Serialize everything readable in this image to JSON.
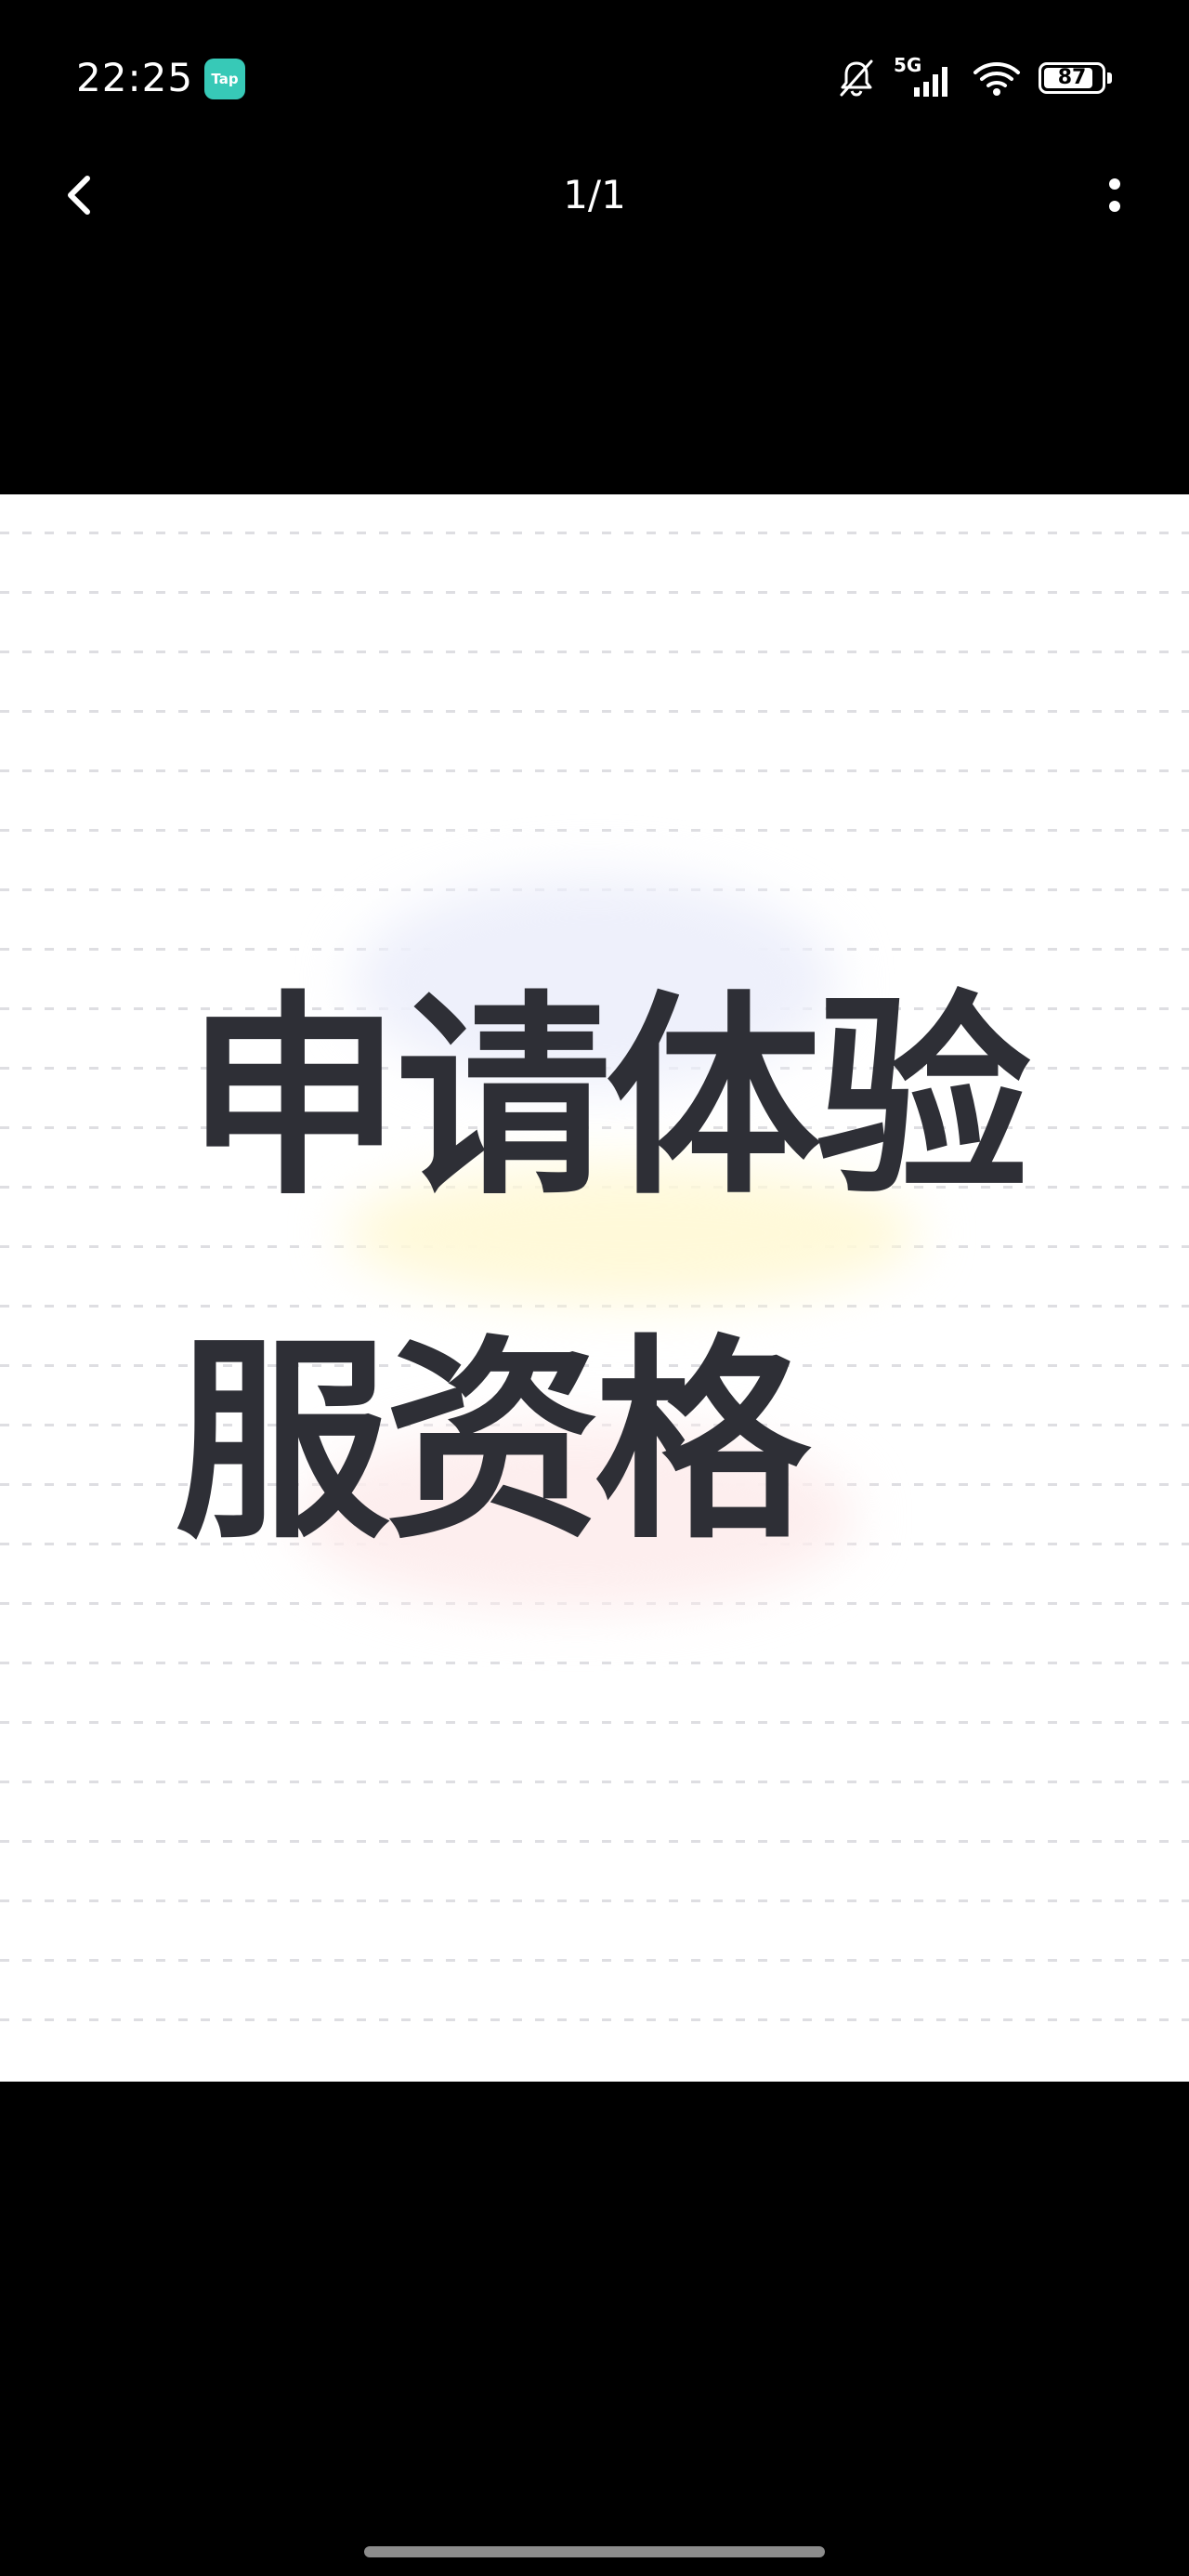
{
  "status_bar": {
    "time": "22:25",
    "app_icon": {
      "name": "tap-icon",
      "label": "Tap",
      "color": "#37c9b7"
    },
    "icons": [
      "muted-bell-icon",
      "cellular-signal-icon",
      "wifi-icon",
      "battery-icon"
    ],
    "network_type": "5G",
    "battery_level": "87",
    "battery_fraction": 0.87
  },
  "top_nav": {
    "back_icon": "chevron-left-icon",
    "page_counter": "1/1",
    "more_icon": "more-vertical-icon"
  },
  "image": {
    "headline_line_1": "申请体验",
    "headline_line_2": "服资格",
    "text_color": "#2e2f36",
    "background": "#ffffff"
  }
}
